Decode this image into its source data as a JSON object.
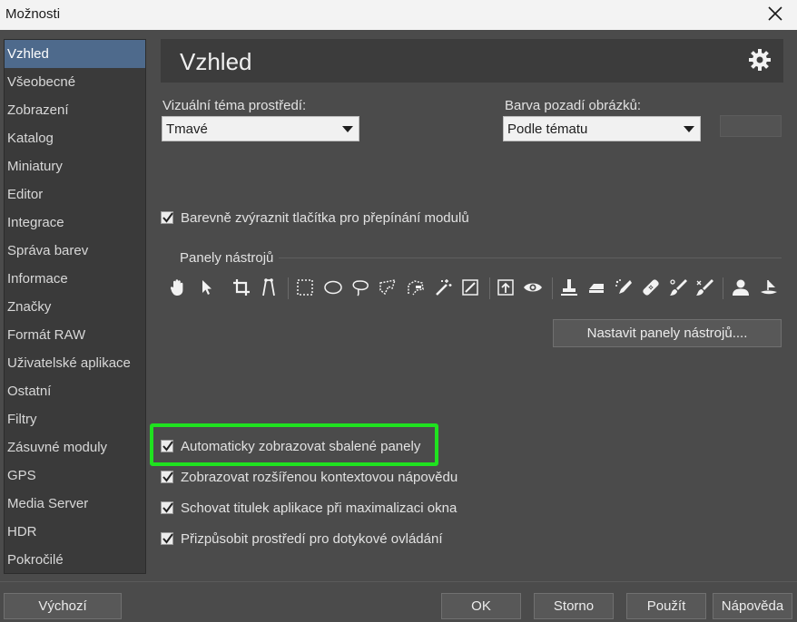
{
  "window": {
    "title": "Možnosti",
    "close_icon": "close-icon"
  },
  "sidebar": {
    "items": [
      {
        "label": "Vzhled",
        "selected": true
      },
      {
        "label": "Všeobecné"
      },
      {
        "label": "Zobrazení"
      },
      {
        "label": "Katalog"
      },
      {
        "label": "Miniatury"
      },
      {
        "label": "Editor"
      },
      {
        "label": "Integrace"
      },
      {
        "label": "Správa barev"
      },
      {
        "label": "Informace"
      },
      {
        "label": "Značky"
      },
      {
        "label": "Formát RAW"
      },
      {
        "label": "Uživatelské aplikace"
      },
      {
        "label": "Ostatní"
      },
      {
        "label": "Filtry"
      },
      {
        "label": "Zásuvné moduly"
      },
      {
        "label": "GPS"
      },
      {
        "label": "Media Server"
      },
      {
        "label": "HDR"
      },
      {
        "label": "Pokročilé"
      }
    ]
  },
  "header": {
    "title": "Vzhled",
    "icon": "gear-icon"
  },
  "theme": {
    "label": "Vizuální téma prostředí:",
    "value": "Tmavé"
  },
  "bgcolor": {
    "label": "Barva pozadí obrázků:",
    "value": "Podle tématu"
  },
  "options": {
    "highlight_module_buttons": {
      "label": "Barevně zvýraznit tlačítka pro přepínání modulů",
      "checked": true
    },
    "auto_show_collapsed": {
      "label": "Automaticky zobrazovat sbalené panely",
      "checked": true
    },
    "extended_help": {
      "label": "Zobrazovat rozšířenou kontextovou nápovědu",
      "checked": true
    },
    "hide_title": {
      "label": "Schovat titulek aplikace při maximalizaci okna",
      "checked": true
    },
    "touch": {
      "label": "Přizpůsobit prostředí pro dotykové ovládání",
      "checked": true
    }
  },
  "toolbars": {
    "group_label": "Panely nástrojů",
    "configure_button": "Nastavit panely nástrojů....",
    "tools": [
      "hand-icon",
      "pointer-icon",
      "crop-icon",
      "straighten-icon",
      "rect-select-icon",
      "ellipse-select-icon",
      "lasso-icon",
      "polygon-lasso-icon",
      "magnetic-lasso-icon",
      "magic-wand-icon",
      "select-all-icon",
      "upload-icon",
      "red-eye-icon",
      "stamp-icon",
      "eraser-icon",
      "spot-heal-icon",
      "bandage-icon",
      "brush-icon",
      "brush-alt-icon",
      "person-icon",
      "sail-icon"
    ]
  },
  "footer": {
    "default_button": "Výchozí",
    "ok_button": "OK",
    "cancel_button": "Storno",
    "apply_button": "Použít",
    "help_button": "Nápověda"
  },
  "colors": {
    "highlight": "#1fe21f",
    "selected": "#4e6a8c"
  }
}
